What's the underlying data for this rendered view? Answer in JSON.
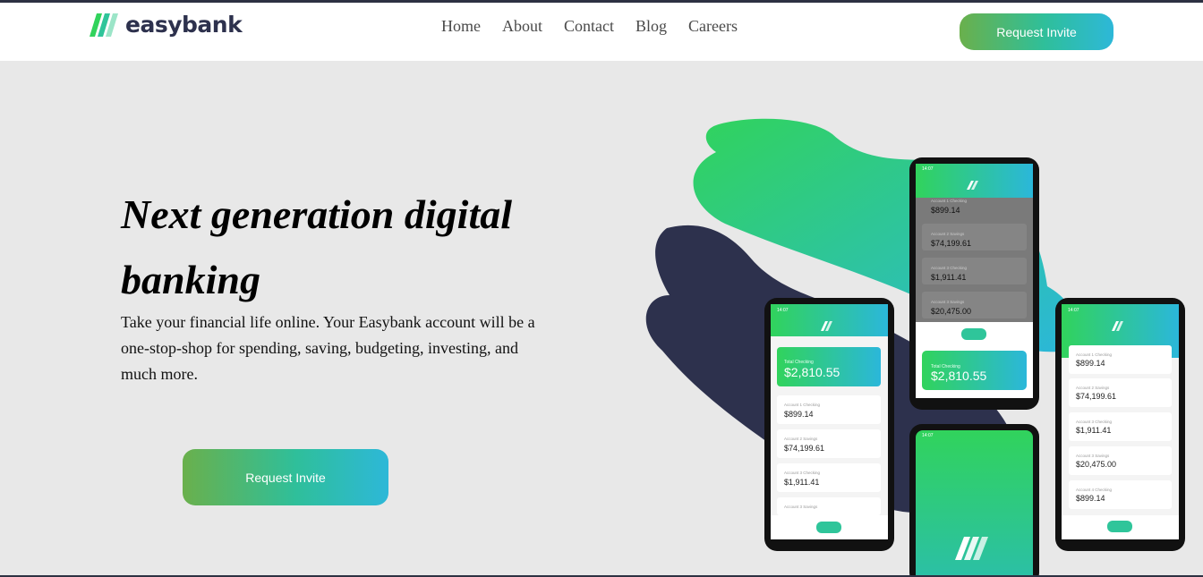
{
  "brand": {
    "name": "easybank"
  },
  "nav": {
    "items": [
      "Home",
      "About",
      "Contact",
      "Blog",
      "Careers"
    ]
  },
  "header": {
    "cta_label": "Request Invite"
  },
  "hero": {
    "title": "Next generation digital banking",
    "description": "Take your financial life online. Your Easybank account will be a one-stop-shop for spending, saving, budgeting, investing, and much more.",
    "cta_label": "Request Invite"
  },
  "phones": {
    "time": "14:07",
    "total_label": "Total Checking",
    "total_value": "$2,810.55",
    "accounts": [
      {
        "label": "Account 1 Checking",
        "value": "$899.14"
      },
      {
        "label": "Account 2 Savings",
        "value": "$74,199.61"
      },
      {
        "label": "Account 3 Checking",
        "value": "$1,911.41"
      },
      {
        "label": "Account 3 Savings",
        "value": "$20,475.00"
      },
      {
        "label": "Account 4 Checking",
        "value": "$899.14"
      }
    ]
  },
  "colors": {
    "brand_green": "#31d35c",
    "brand_cyan": "#2bb7da",
    "navy": "#2d314d"
  }
}
